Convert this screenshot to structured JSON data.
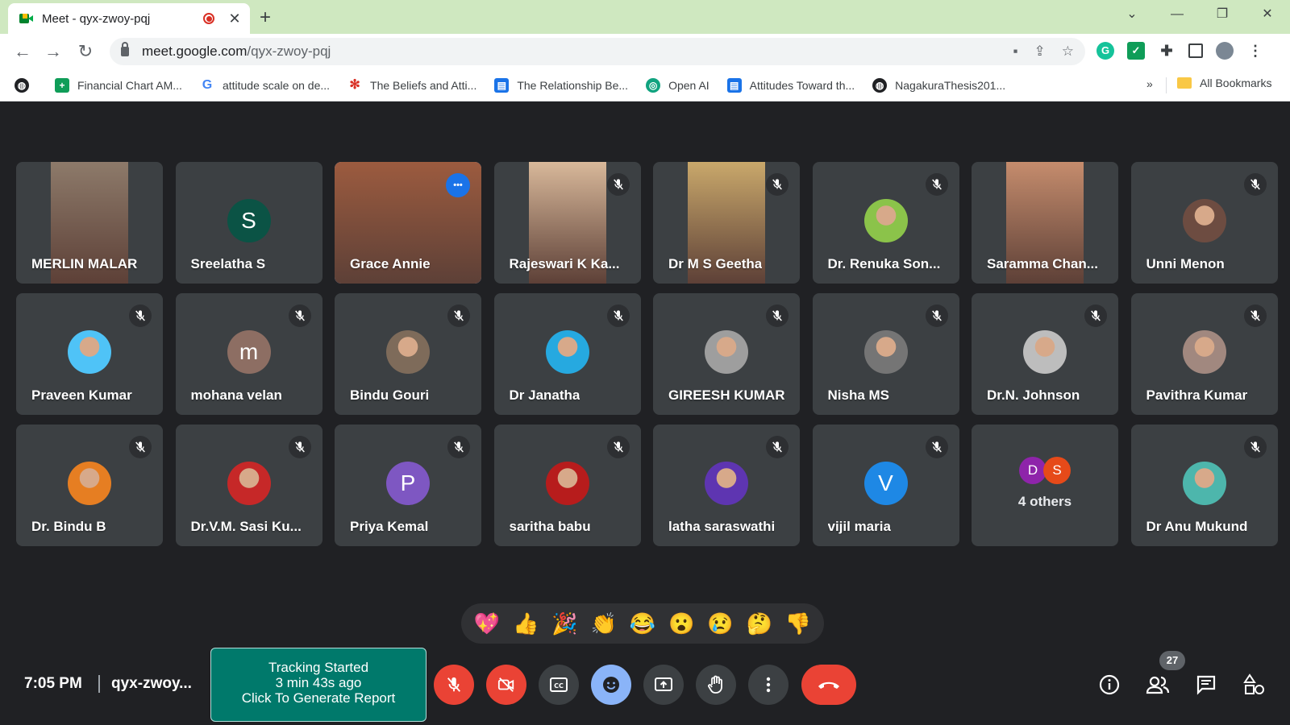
{
  "browser": {
    "tab_title": "Meet - qyx-zwoy-pqj",
    "tab_close": "✕",
    "new_tab": "+",
    "url_host": "meet.google.com",
    "url_path": "/qyx-zwoy-pqj",
    "window_controls": [
      "⌄",
      "—",
      "❐",
      "✕"
    ],
    "bookmarks": [
      {
        "label": "Financial Chart AM...",
        "icon": "sheets-icon",
        "color": "#0f9d58"
      },
      {
        "label": "attitude scale on de...",
        "icon": "google-icon",
        "color": "#ffffff"
      },
      {
        "label": "The Beliefs and Atti...",
        "icon": "dots-icon",
        "color": "#ffffff"
      },
      {
        "label": "The Relationship Be...",
        "icon": "doc-icon",
        "color": "#1a73e8"
      },
      {
        "label": "Open AI",
        "icon": "openai-icon",
        "color": "#10a37f"
      },
      {
        "label": "Attitudes Toward th...",
        "icon": "doc-icon",
        "color": "#1a73e8"
      },
      {
        "label": "NagakuraThesis201...",
        "icon": "globe-icon",
        "color": "#202124"
      }
    ],
    "bookmarks_more": "»",
    "all_bookmarks": "All Bookmarks"
  },
  "participants": [
    {
      "name": "MERLIN MALAR",
      "type": "video",
      "muted": false,
      "color": "#8d7a6a"
    },
    {
      "name": "Sreelatha S",
      "type": "letter",
      "letter": "S",
      "muted": false,
      "color": "#0b5345"
    },
    {
      "name": "Grace Annie",
      "type": "video",
      "muted": false,
      "active": true,
      "color": "#9c5b3f"
    },
    {
      "name": "Rajeswari K Ka...",
      "type": "video",
      "muted": true,
      "color": "#d8b89a"
    },
    {
      "name": "Dr M S Geetha",
      "type": "video",
      "muted": true,
      "color": "#c9a86b"
    },
    {
      "name": "Dr. Renuka Son...",
      "type": "photo",
      "muted": true,
      "color": "#8bc34a"
    },
    {
      "name": "Saramma Chan...",
      "type": "video",
      "muted": false,
      "color": "#c58c6d"
    },
    {
      "name": "Unni Menon",
      "type": "photo",
      "muted": true,
      "color": "#6d4c41"
    },
    {
      "name": "Praveen Kumar",
      "type": "photo",
      "muted": true,
      "color": "#4fc3f7"
    },
    {
      "name": "mohana velan",
      "type": "letter",
      "letter": "m",
      "muted": true,
      "color": "#8d6e63"
    },
    {
      "name": "Bindu Gouri",
      "type": "photo",
      "muted": true,
      "color": "#7e6b5a"
    },
    {
      "name": "Dr Janatha",
      "type": "photo",
      "muted": true,
      "color": "#26a9e0"
    },
    {
      "name": "GIREESH KUMAR",
      "type": "photo",
      "muted": true,
      "color": "#9e9e9e"
    },
    {
      "name": "Nisha MS",
      "type": "photo",
      "muted": true,
      "color": "#757575"
    },
    {
      "name": "Dr.N. Johnson",
      "type": "photo",
      "muted": true,
      "color": "#bdbdbd"
    },
    {
      "name": "Pavithra Kumar",
      "type": "photo",
      "muted": true,
      "color": "#a1887f"
    },
    {
      "name": "Dr. Bindu B",
      "type": "photo",
      "muted": true,
      "color": "#e67e22"
    },
    {
      "name": "Dr.V.M. Sasi Ku...",
      "type": "photo",
      "muted": true,
      "color": "#c62828"
    },
    {
      "name": "Priya Kemal",
      "type": "letter",
      "letter": "P",
      "muted": true,
      "color": "#7e57c2"
    },
    {
      "name": "saritha babu",
      "type": "photo",
      "muted": true,
      "color": "#b71c1c"
    },
    {
      "name": "latha saraswathi",
      "type": "photo",
      "muted": true,
      "color": "#5e35b1"
    },
    {
      "name": "vijil maria",
      "type": "letter",
      "letter": "V",
      "muted": true,
      "color": "#1e88e5"
    },
    {
      "name": "4 others",
      "type": "others",
      "letters": [
        "D",
        "S"
      ],
      "letter_colors": [
        "#8e24aa",
        "#e64a19"
      ],
      "muted": false
    },
    {
      "name": "Dr Anu Mukund",
      "type": "photo",
      "muted": true,
      "color": "#4db6ac"
    }
  ],
  "reactions": [
    "💖",
    "👍",
    "🎉",
    "👏",
    "😂",
    "😮",
    "😢",
    "🤔",
    "👎"
  ],
  "bottom": {
    "time": "7:05 PM",
    "meeting_code": "qyx-zwoy...",
    "tracker_line1": "Tracking Started",
    "tracker_line2": "3 min 43s ago",
    "tracker_line3": "Click To Generate Report",
    "people_count": "27"
  },
  "colors": {
    "meet_bg": "#202124",
    "tile_bg": "#3c4043",
    "danger": "#ea4335",
    "accent": "#8ab4f8",
    "tracker": "#00796b"
  }
}
